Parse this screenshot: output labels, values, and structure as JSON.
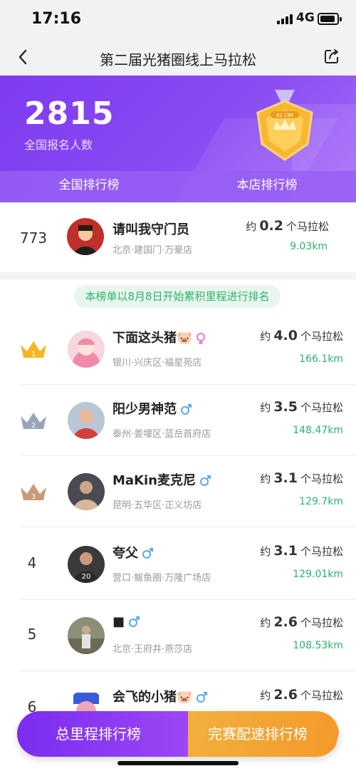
{
  "status": {
    "time": "17:16",
    "network": "4G"
  },
  "nav": {
    "title": "第二届光猪圈线上马拉松"
  },
  "hero": {
    "count": "2815",
    "count_label": "全国报名人数",
    "badge_text": "42.195"
  },
  "tabs": [
    {
      "label": "全国排行榜",
      "active": true
    },
    {
      "label": "本店排行榜",
      "active": false
    }
  ],
  "my_entry": {
    "rank": "773",
    "name": "请叫我守门员",
    "store": "北京·建国门·万豪店",
    "prefix": "约",
    "value": "0.2",
    "unit": "个马拉松",
    "km": "9.03km"
  },
  "notice": "本榜单以8月8日开始累积里程进行排名",
  "rows": [
    {
      "rank": "1",
      "name": "下面这头猪🐷",
      "gender": "female",
      "store": "银川·兴庆区·福星苑店",
      "prefix": "约",
      "value": "4.0",
      "unit": "个马拉松",
      "km": "166.1km"
    },
    {
      "rank": "2",
      "name": "阳少男神范",
      "gender": "male",
      "store": "泰州·姜堰区·蓝岳首府店",
      "prefix": "约",
      "value": "3.5",
      "unit": "个马拉松",
      "km": "148.47km"
    },
    {
      "rank": "3",
      "name": "MaKin麦克尼",
      "gender": "male",
      "store": "昆明·五华区·正义坊店",
      "prefix": "约",
      "value": "3.1",
      "unit": "个马拉松",
      "km": "129.7km"
    },
    {
      "rank": "4",
      "name": "夸父",
      "gender": "male",
      "store": "营口·鲅鱼圈·万隆广场店",
      "prefix": "约",
      "value": "3.1",
      "unit": "个马拉松",
      "km": "129.01km"
    },
    {
      "rank": "5",
      "name": "■",
      "gender": "male",
      "store": "北京·王府井·燕莎店",
      "prefix": "约",
      "value": "2.6",
      "unit": "个马拉松",
      "km": "108.53km"
    },
    {
      "rank": "6",
      "name": "会飞的小猪🐷",
      "gender": "male",
      "store": "",
      "prefix": "约",
      "value": "2.6",
      "unit": "个马拉松",
      "km": ""
    }
  ],
  "bottom": {
    "left_label": "总里程排行榜",
    "right_label": "完赛配速排行榜"
  },
  "colors": {
    "purple": "#7e3bf1",
    "green": "#2db36a",
    "orange": "#f2a63a",
    "gold": "#f5b623",
    "silver": "#9aa4b8",
    "bronze": "#c99a7a"
  }
}
